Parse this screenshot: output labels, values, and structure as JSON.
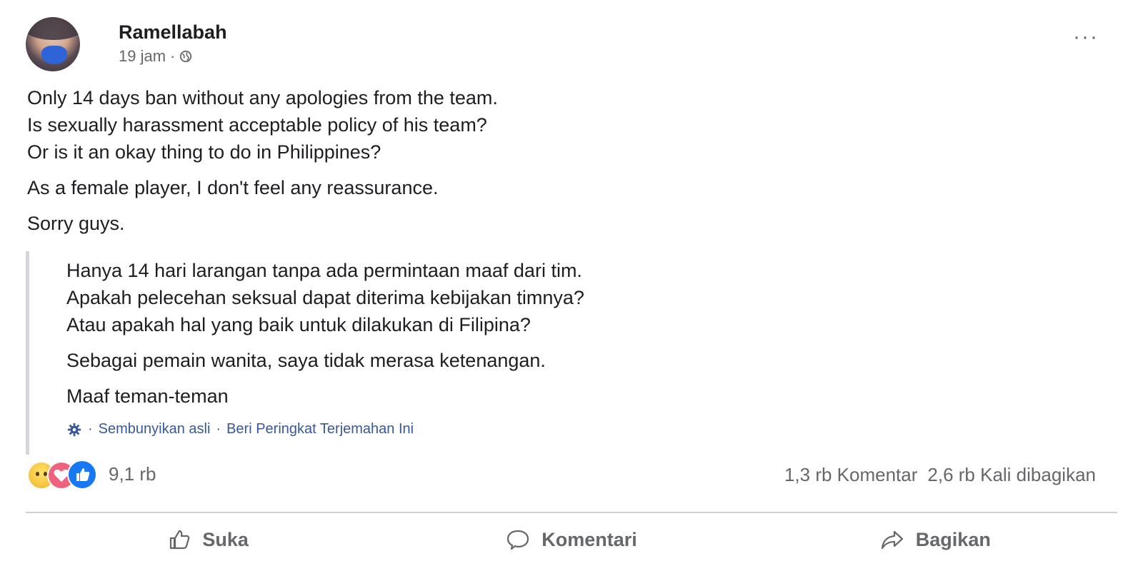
{
  "post": {
    "author": "Ramellabah",
    "time": "19 jam",
    "separator": "·",
    "more_label": "···",
    "body": [
      "Only 14 days ban without any apologies from the team.",
      "Is sexually harassment acceptable policy of his team?",
      "Or is it an okay thing to do in Philippines?",
      "As a female player, I don't feel any reassurance.",
      "Sorry guys."
    ],
    "translation": [
      "Hanya 14 hari larangan tanpa ada permintaan maaf dari tim.",
      "Apakah pelecehan seksual dapat diterima kebijakan timnya?",
      "Atau apakah hal yang baik untuk dilakukan di Filipina?",
      "Sebagai pemain wanita, saya tidak merasa ketenangan.",
      "Maaf teman-teman"
    ],
    "translation_links": {
      "sep1": "·",
      "hide_original": "Sembunyikan asli",
      "sep2": "·",
      "rate_translation": "Beri Peringkat Terjemahan Ini"
    }
  },
  "reactions": {
    "count": "9,1 rb",
    "icons": [
      "sad-reaction-icon",
      "love-reaction-icon",
      "like-reaction-icon"
    ]
  },
  "stats": {
    "comments": "1,3 rb Komentar",
    "shares": "2,6 rb Kali dibagikan"
  },
  "actions": {
    "like": "Suka",
    "comment": "Komentari",
    "share": "Bagikan"
  },
  "colors": {
    "link": "#385898",
    "muted": "#65676b",
    "like_blue": "#1877f2"
  }
}
